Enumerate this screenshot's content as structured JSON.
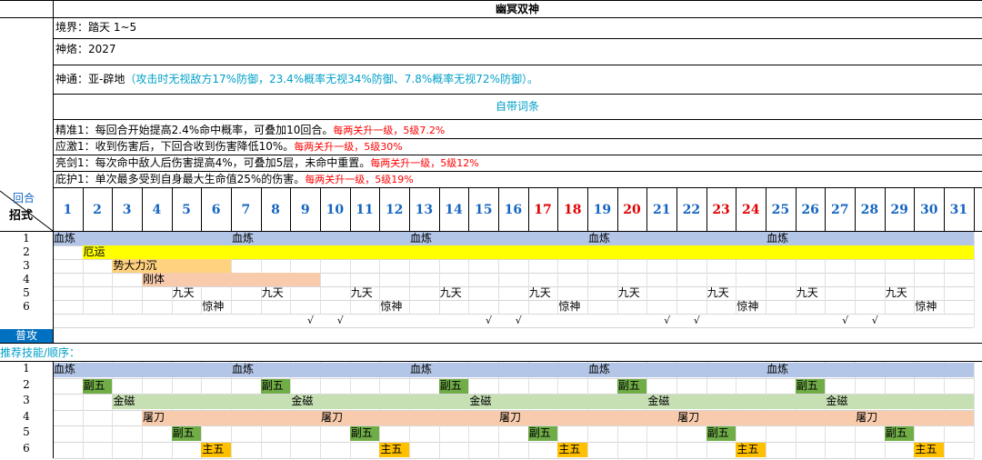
{
  "title": "幽冥双神",
  "info": {
    "realm": "境界：踏天 1~5",
    "shenhao": "神烙：2027",
    "shentong_main": "神通：亚-辟地",
    "shentong_detail": "（攻击时无视敌方17%防御，23.4%概率无视34%防御、7.8%概率无视72%防御）。"
  },
  "affix_title": "自带词条",
  "affixes": [
    {
      "main": "精准1：每回合开始提高2.4%命中概率，可叠加10回合。",
      "note": "每两关升一级，5级7.2%"
    },
    {
      "main": "应激1：收到伤害后，下回合收到伤害降低10%。",
      "note": "每两关升一级，5级30%"
    },
    {
      "main": "亮剑1：每次命中敌人后伤害提高4%，可叠加5层，未命中重置。",
      "note": "每两关升一级，5级12%"
    },
    {
      "main": "庇护1：单次最多受到自身最大生命值25%的伤害。",
      "note": "每两关升一级，5级19%"
    }
  ],
  "header": {
    "round": "回合",
    "move": "招式"
  },
  "rounds": [
    "1",
    "2",
    "3",
    "4",
    "5",
    "6",
    "7",
    "8",
    "9",
    "10",
    "11",
    "12",
    "13",
    "14",
    "15",
    "16",
    "17",
    "18",
    "19",
    "20",
    "21",
    "22",
    "23",
    "24",
    "25",
    "26",
    "27",
    "28",
    "29",
    "30",
    "31"
  ],
  "red_rounds": [
    "17",
    "18",
    "20",
    "23",
    "24"
  ],
  "skill_rows": [
    "1",
    "2",
    "3",
    "4",
    "5",
    "6"
  ],
  "attack_label": "普攻",
  "recommend_label": "推荐技能/顺序：",
  "rec_rows": [
    "1",
    "2",
    "3",
    "4",
    "5",
    "6"
  ],
  "colors": {
    "blue": "#b4c6e7",
    "yellow": "#ffff00",
    "orange": "#ffd27f",
    "peach": "#f8cbad",
    "green": "#70ad47",
    "lightgreen": "#c6e0b4",
    "gold": "#ffc000",
    "sel": "#0070c0",
    "cyan_text": "#00a0c8",
    "red_text": "#ff0000",
    "num_blue": "#1565c0"
  },
  "skill_segments": [
    {
      "row": 1,
      "start": 1,
      "end": 31,
      "color": "blue",
      "labels": [
        {
          "col": 1,
          "text": "血炼"
        },
        {
          "col": 7,
          "text": "血炼"
        },
        {
          "col": 13,
          "text": "血炼"
        },
        {
          "col": 19,
          "text": "血炼"
        },
        {
          "col": 25,
          "text": "血炼"
        }
      ]
    },
    {
      "row": 2,
      "start": 2,
      "end": 31,
      "color": "yellow",
      "labels": [
        {
          "col": 2,
          "text": "厄运"
        }
      ]
    },
    {
      "row": 3,
      "start": 3,
      "end": 6,
      "color": "orange",
      "labels": [
        {
          "col": 3,
          "text": "势大力沉"
        }
      ]
    },
    {
      "row": 4,
      "start": 4,
      "end": 9,
      "color": "peach",
      "labels": [
        {
          "col": 4,
          "text": "刚体"
        }
      ]
    },
    {
      "row": 5,
      "start": 0,
      "end": 0,
      "color": "",
      "labels": [
        {
          "col": 5,
          "text": "九天"
        },
        {
          "col": 8,
          "text": "九天"
        },
        {
          "col": 11,
          "text": "九天"
        },
        {
          "col": 14,
          "text": "九天"
        },
        {
          "col": 17,
          "text": "九天"
        },
        {
          "col": 20,
          "text": "九天"
        },
        {
          "col": 23,
          "text": "九天"
        },
        {
          "col": 26,
          "text": "九天"
        },
        {
          "col": 29,
          "text": "九天"
        }
      ]
    },
    {
      "row": 6,
      "start": 0,
      "end": 0,
      "color": "",
      "labels": [
        {
          "col": 6,
          "text": "惊神"
        },
        {
          "col": 12,
          "text": "惊神"
        },
        {
          "col": 18,
          "text": "惊神"
        },
        {
          "col": 24,
          "text": "惊神"
        },
        {
          "col": 30,
          "text": "惊神"
        }
      ]
    }
  ],
  "attack_ticks": {
    "cols": [
      9,
      10,
      15,
      16,
      21,
      22,
      27,
      28
    ],
    "text": "√"
  },
  "rec_segments": [
    {
      "row": 1,
      "bars": [
        {
          "start": 1,
          "end": 31,
          "color": "blue"
        }
      ],
      "labels": [
        {
          "col": 1,
          "text": "血炼"
        },
        {
          "col": 7,
          "text": "血炼"
        },
        {
          "col": 13,
          "text": "血炼"
        },
        {
          "col": 19,
          "text": "血炼"
        },
        {
          "col": 25,
          "text": "血炼"
        }
      ]
    },
    {
      "row": 2,
      "bars": [
        {
          "start": 2,
          "end": 2,
          "color": "green"
        },
        {
          "start": 8,
          "end": 8,
          "color": "green"
        },
        {
          "start": 14,
          "end": 14,
          "color": "green"
        },
        {
          "start": 20,
          "end": 20,
          "color": "green"
        },
        {
          "start": 26,
          "end": 26,
          "color": "green"
        }
      ],
      "labels": [
        {
          "col": 2,
          "text": "副五"
        },
        {
          "col": 8,
          "text": "副五"
        },
        {
          "col": 14,
          "text": "副五"
        },
        {
          "col": 20,
          "text": "副五"
        },
        {
          "col": 26,
          "text": "副五"
        }
      ]
    },
    {
      "row": 3,
      "bars": [
        {
          "start": 3,
          "end": 31,
          "color": "lightgreen"
        }
      ],
      "labels": [
        {
          "col": 3,
          "text": "金磁"
        },
        {
          "col": 9,
          "text": "金磁"
        },
        {
          "col": 15,
          "text": "金磁"
        },
        {
          "col": 21,
          "text": "金磁"
        },
        {
          "col": 27,
          "text": "金磁"
        }
      ]
    },
    {
      "row": 4,
      "bars": [
        {
          "start": 4,
          "end": 31,
          "color": "peach"
        }
      ],
      "labels": [
        {
          "col": 4,
          "text": "屠刀"
        },
        {
          "col": 10,
          "text": "屠刀"
        },
        {
          "col": 16,
          "text": "屠刀"
        },
        {
          "col": 22,
          "text": "屠刀"
        },
        {
          "col": 28,
          "text": "屠刀"
        }
      ]
    },
    {
      "row": 5,
      "bars": [
        {
          "start": 5,
          "end": 5,
          "color": "green"
        },
        {
          "start": 11,
          "end": 11,
          "color": "green"
        },
        {
          "start": 17,
          "end": 17,
          "color": "green"
        },
        {
          "start": 23,
          "end": 23,
          "color": "green"
        },
        {
          "start": 29,
          "end": 29,
          "color": "green"
        }
      ],
      "labels": [
        {
          "col": 5,
          "text": "副五"
        },
        {
          "col": 11,
          "text": "副五"
        },
        {
          "col": 17,
          "text": "副五"
        },
        {
          "col": 23,
          "text": "副五"
        },
        {
          "col": 29,
          "text": "副五"
        }
      ]
    },
    {
      "row": 6,
      "bars": [
        {
          "start": 6,
          "end": 6,
          "color": "gold"
        },
        {
          "start": 12,
          "end": 12,
          "color": "gold"
        },
        {
          "start": 18,
          "end": 18,
          "color": "gold"
        },
        {
          "start": 24,
          "end": 24,
          "color": "gold"
        },
        {
          "start": 30,
          "end": 30,
          "color": "gold"
        }
      ],
      "labels": [
        {
          "col": 6,
          "text": "主五"
        },
        {
          "col": 12,
          "text": "主五"
        },
        {
          "col": 18,
          "text": "主五"
        },
        {
          "col": 24,
          "text": "主五"
        },
        {
          "col": 30,
          "text": "主五"
        }
      ]
    }
  ]
}
